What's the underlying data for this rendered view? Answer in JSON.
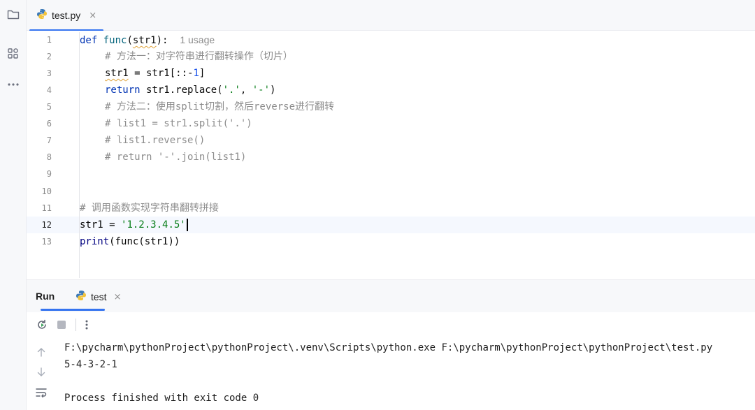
{
  "activity_bar": {
    "icons": [
      "folder-icon",
      "structure-icon",
      "more-icon"
    ]
  },
  "tab": {
    "label": "test.py",
    "close": "×"
  },
  "editor": {
    "line_numbers": [
      "1",
      "2",
      "3",
      "4",
      "5",
      "6",
      "7",
      "8",
      "9",
      "10",
      "11",
      "12",
      "13"
    ],
    "active_line": 12,
    "lines": {
      "l1": {
        "def": "def",
        "fname": "func",
        "open": "(",
        "param": "str1",
        "close": "):",
        "usage": "1 usage"
      },
      "l2": {
        "comment": "# 方法一：对字符串进行翻转操作（切片）"
      },
      "l3": {
        "var": "str1",
        "eq": " = str1[::-",
        "num": "1",
        "end": "]"
      },
      "l4": {
        "ret": "return",
        "body": " str1.replace(",
        "s1": "'.'",
        "comma": ", ",
        "s2": "'-'",
        "end": ")"
      },
      "l5": {
        "comment": "# 方法二：使用split切割，然后reverse进行翻转"
      },
      "l6": {
        "comment": "# list1 = str1.split('.')"
      },
      "l7": {
        "comment": "# list1.reverse()"
      },
      "l8": {
        "comment": "# return '-'.join(list1)"
      },
      "l11": {
        "comment": "# 调用函数实现字符串翻转拼接"
      },
      "l12": {
        "lhs": "str1 = ",
        "str": "'1.2.3.4.5'"
      },
      "l13": {
        "print": "print",
        "rest": "(func(str1))"
      }
    }
  },
  "run_panel": {
    "title": "Run",
    "tab_label": "test",
    "tab_close": "×",
    "toolbar": [
      "rerun-icon",
      "stop-icon",
      "more-icon"
    ],
    "side_icons": [
      "scroll-up-icon",
      "scroll-down-icon",
      "soft-wrap-icon"
    ],
    "console": {
      "command": "F:\\pycharm\\pythonProject\\pythonProject\\.venv\\Scripts\\python.exe F:\\pycharm\\pythonProject\\pythonProject\\test.py",
      "output": "5-4-3-2-1",
      "exit": "Process finished with exit code 0"
    }
  },
  "colors": {
    "accent": "#3574f0",
    "keyword": "#0033b3",
    "string": "#067d17",
    "number": "#1750eb",
    "comment": "#8c8c8c"
  }
}
